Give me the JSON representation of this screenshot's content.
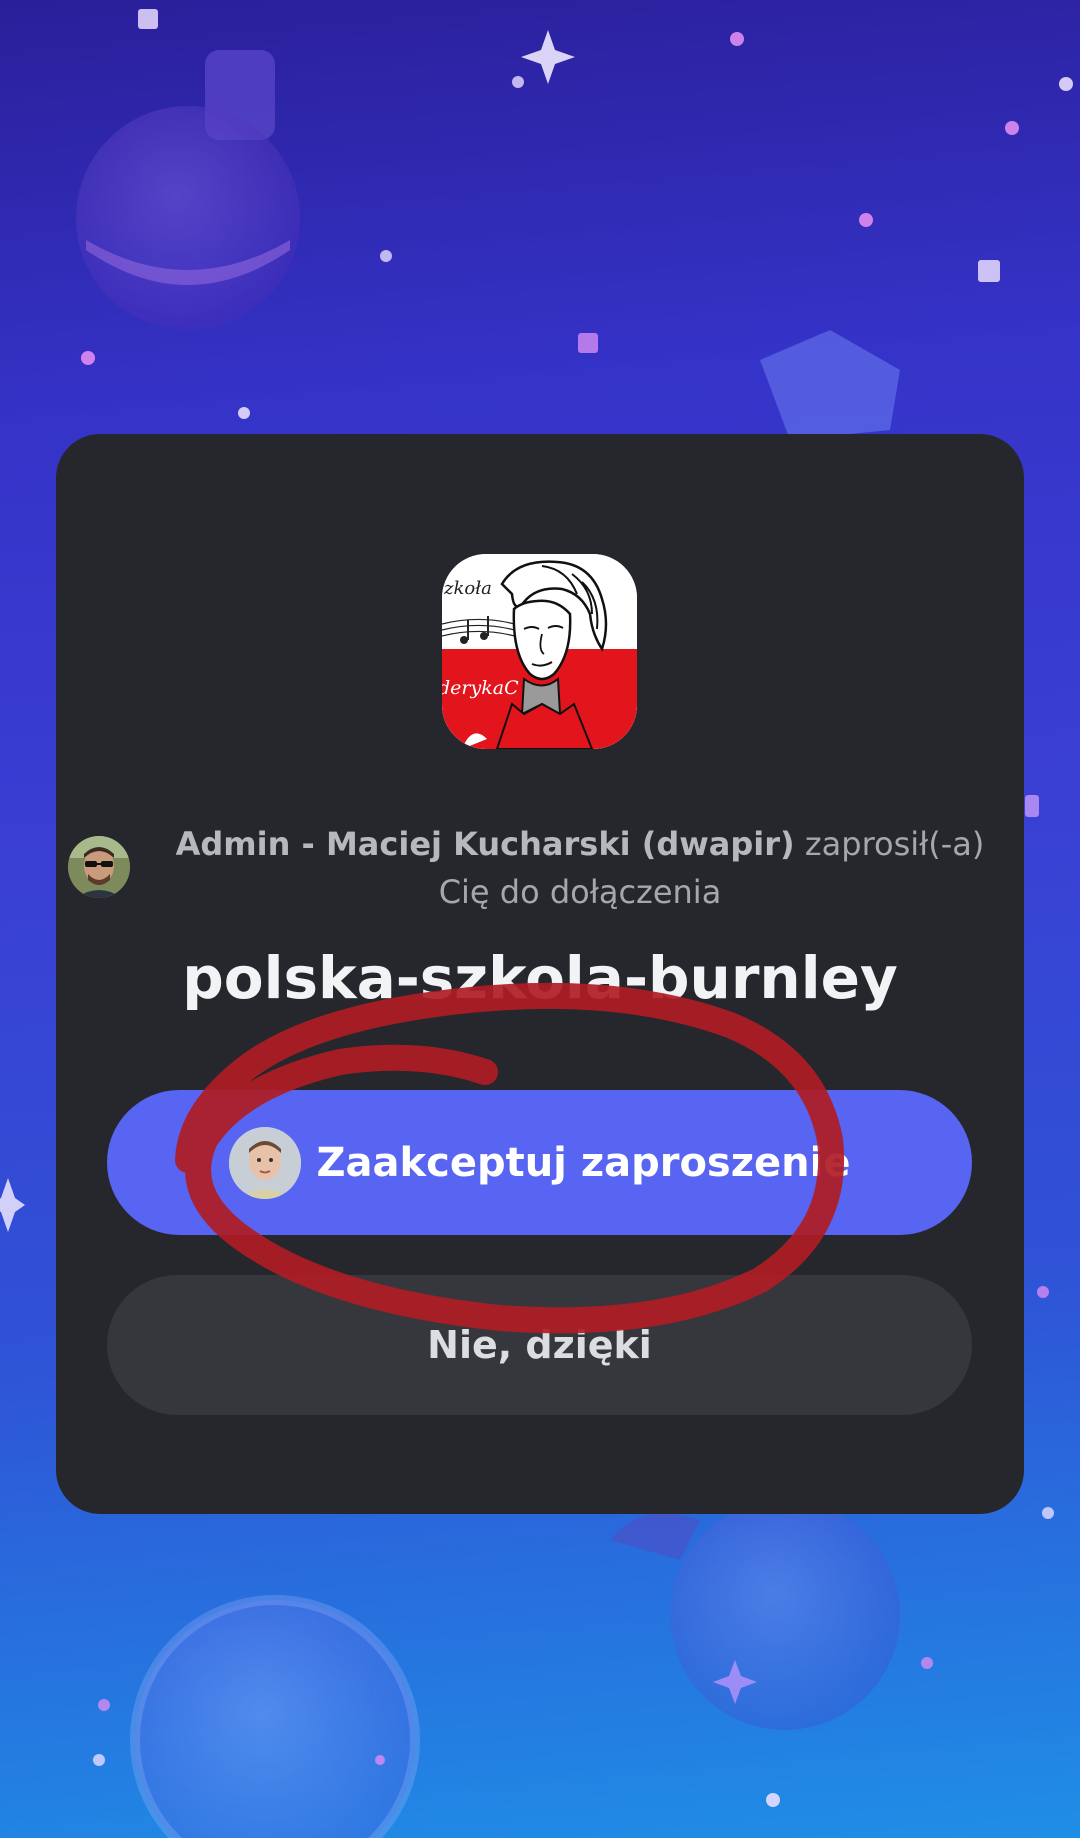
{
  "invite": {
    "inviter_name": "Admin - Maciej Kucharski (dwapir)",
    "invite_message": " zaprosił(-a) Cię do dołączenia",
    "server_name": "polska-szkola-burnley",
    "server_icon_text_top": "zkoła",
    "server_icon_text_mid": "derykaC",
    "accept_label": "Zaakceptuj zaproszenie",
    "decline_label": "Nie, dzięki"
  },
  "colors": {
    "card_bg": "#26272c",
    "accent": "#5865f2",
    "secondary_button": "#36373d",
    "annotation_red": "#b01c24"
  },
  "icons": {
    "server_icon": "server-avatar-chopin",
    "inviter_avatar": "user-avatar",
    "accept_avatar": "user-avatar-child"
  }
}
